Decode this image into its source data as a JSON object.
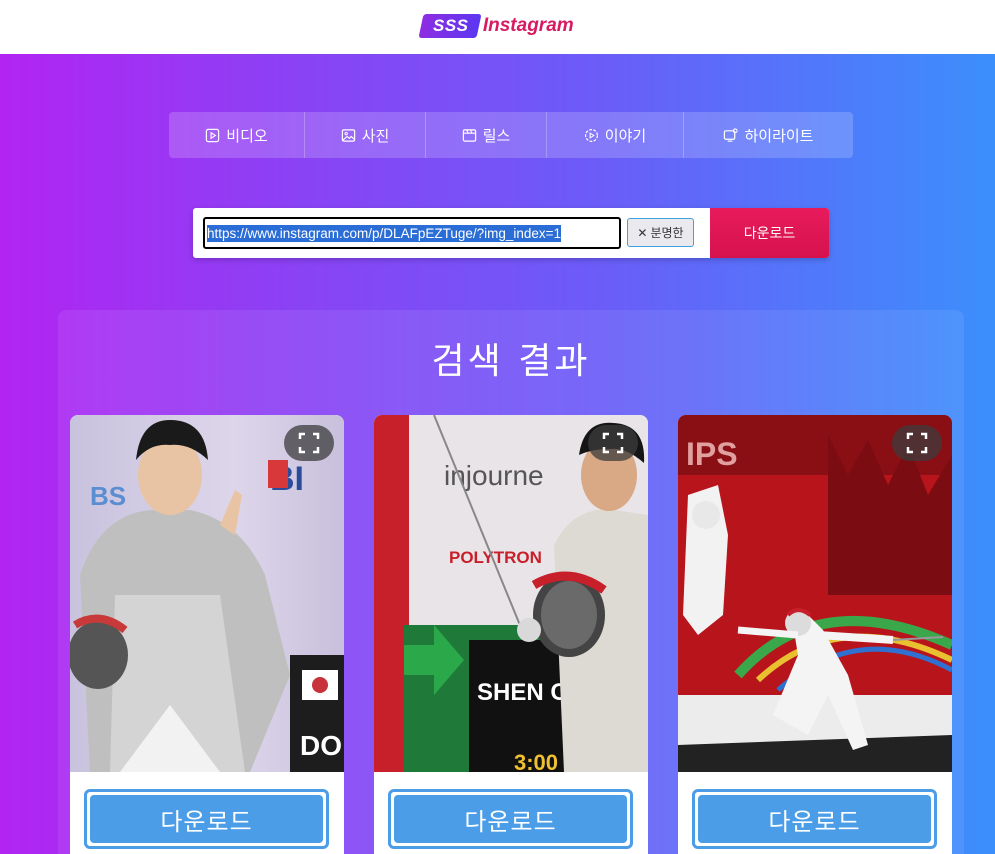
{
  "header": {
    "logo_badge": "SSS",
    "logo_text": "Instagram"
  },
  "tabs": [
    {
      "label": "비디오",
      "icon": "video-icon"
    },
    {
      "label": "사진",
      "icon": "image-icon"
    },
    {
      "label": "릴스",
      "icon": "reels-icon"
    },
    {
      "label": "이야기",
      "icon": "story-icon"
    },
    {
      "label": "하이라이트",
      "icon": "highlight-icon"
    }
  ],
  "search": {
    "url_value": "https://www.instagram.com/p/DLAFpEZTuge/?img_index=1",
    "clear_label": "분명한",
    "download_label": "다운로드"
  },
  "results": {
    "title": "검색 결과",
    "cards": [
      {
        "download_label": "다운로드",
        "photo_desc": "fencer-smiling"
      },
      {
        "download_label": "다운로드",
        "photo_desc": "fencer-with-mask",
        "scoreboard_text": "SHEN Cho"
      },
      {
        "download_label": "다운로드",
        "photo_desc": "fencer-lunging"
      }
    ]
  },
  "colors": {
    "accent_pink": "#d81b60",
    "download_red": "#e81b5c",
    "card_button_blue": "#4a9de6"
  }
}
